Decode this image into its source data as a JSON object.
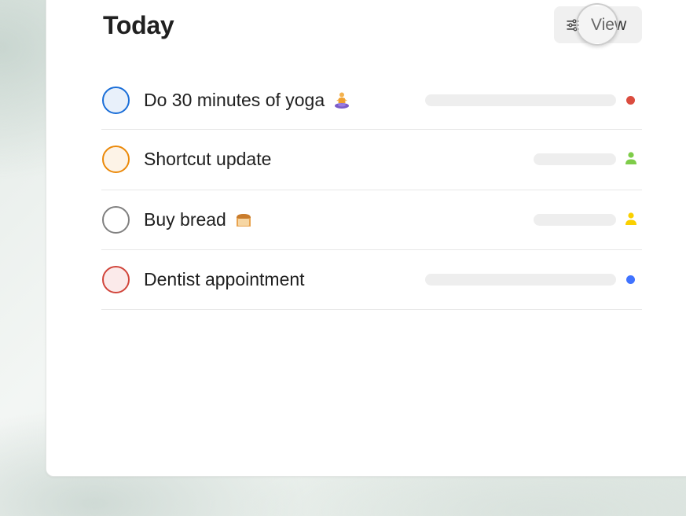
{
  "header": {
    "title": "Today",
    "view_button_label": "View",
    "view_icon": "sliders-icon"
  },
  "tasks": [
    {
      "label": "Do 30 minutes of yoga",
      "emoji": "person-in-lotus-position",
      "checkbox_color": "#1a6ed8",
      "checkbox_fill": "#e8f0fa",
      "indicator": "dot",
      "indicator_color": "#db4c3f"
    },
    {
      "label": "Shortcut update",
      "emoji": "",
      "checkbox_color": "#eb8909",
      "checkbox_fill": "#fdf3e7",
      "indicator": "person-icon",
      "indicator_color": "#7ecc49"
    },
    {
      "label": "Buy bread",
      "emoji": "bread",
      "checkbox_color": "#808080",
      "checkbox_fill": "#ffffff",
      "indicator": "person-icon",
      "indicator_color": "#fad000"
    },
    {
      "label": "Dentist appointment",
      "emoji": "",
      "checkbox_color": "#d1453b",
      "checkbox_fill": "#fbeaea",
      "indicator": "dot",
      "indicator_color": "#4073ff"
    }
  ]
}
